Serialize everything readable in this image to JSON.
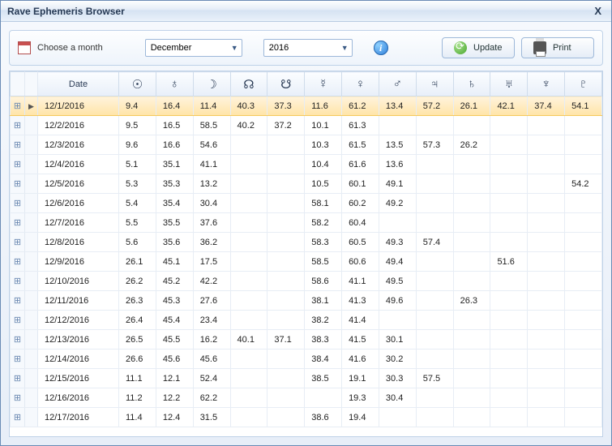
{
  "window": {
    "title": "Rave Ephemeris Browser",
    "close": "X"
  },
  "toolbar": {
    "choose_label": "Choose a month",
    "month_value": "December",
    "year_value": "2016",
    "update_label": "Update",
    "print_label": "Print"
  },
  "columns": [
    {
      "key": "date",
      "label": "Date",
      "header_type": "text"
    },
    {
      "key": "sun",
      "label": "☉",
      "header_type": "symbol"
    },
    {
      "key": "earth",
      "label": "♁",
      "header_type": "symbol"
    },
    {
      "key": "moon",
      "label": "☽",
      "header_type": "symbol"
    },
    {
      "key": "north_node",
      "label": "☊",
      "header_type": "symbol"
    },
    {
      "key": "south_node",
      "label": "☋",
      "header_type": "symbol"
    },
    {
      "key": "mercury",
      "label": "☿",
      "header_type": "symbol"
    },
    {
      "key": "venus",
      "label": "♀",
      "header_type": "symbol"
    },
    {
      "key": "mars",
      "label": "♂",
      "header_type": "symbol"
    },
    {
      "key": "jupiter",
      "label": "♃",
      "header_type": "symbol"
    },
    {
      "key": "saturn",
      "label": "♄",
      "header_type": "symbol"
    },
    {
      "key": "uranus",
      "label": "♅",
      "header_type": "symbol"
    },
    {
      "key": "neptune",
      "label": "♆",
      "header_type": "symbol"
    },
    {
      "key": "pluto",
      "label": "♇",
      "header_type": "symbol"
    }
  ],
  "rows": [
    {
      "selected": true,
      "date": "12/1/2016",
      "vals": [
        "9.4",
        "16.4",
        "11.4",
        "40.3",
        "37.3",
        "11.6",
        "61.2",
        "13.4",
        "57.2",
        "26.1",
        "42.1",
        "37.4",
        "54.1"
      ]
    },
    {
      "date": "12/2/2016",
      "vals": [
        "9.5",
        "16.5",
        "58.5",
        "40.2",
        "37.2",
        "10.1",
        "61.3",
        "",
        "",
        "",
        "",
        "",
        ""
      ]
    },
    {
      "date": "12/3/2016",
      "vals": [
        "9.6",
        "16.6",
        "54.6",
        "",
        "",
        "10.3",
        "61.5",
        "13.5",
        "57.3",
        "26.2",
        "",
        "",
        ""
      ]
    },
    {
      "date": "12/4/2016",
      "vals": [
        "5.1",
        "35.1",
        "41.1",
        "",
        "",
        "10.4",
        "61.6",
        "13.6",
        "",
        "",
        "",
        "",
        ""
      ]
    },
    {
      "date": "12/5/2016",
      "vals": [
        "5.3",
        "35.3",
        "13.2",
        "",
        "",
        "10.5",
        "60.1",
        "49.1",
        "",
        "",
        "",
        "",
        "54.2"
      ]
    },
    {
      "date": "12/6/2016",
      "vals": [
        "5.4",
        "35.4",
        "30.4",
        "",
        "",
        "58.1",
        "60.2",
        "49.2",
        "",
        "",
        "",
        "",
        ""
      ]
    },
    {
      "date": "12/7/2016",
      "vals": [
        "5.5",
        "35.5",
        "37.6",
        "",
        "",
        "58.2",
        "60.4",
        "",
        "",
        "",
        "",
        "",
        ""
      ]
    },
    {
      "date": "12/8/2016",
      "vals": [
        "5.6",
        "35.6",
        "36.2",
        "",
        "",
        "58.3",
        "60.5",
        "49.3",
        "57.4",
        "",
        "",
        "",
        ""
      ]
    },
    {
      "date": "12/9/2016",
      "vals": [
        "26.1",
        "45.1",
        "17.5",
        "",
        "",
        "58.5",
        "60.6",
        "49.4",
        "",
        "",
        "51.6",
        "",
        ""
      ]
    },
    {
      "date": "12/10/2016",
      "vals": [
        "26.2",
        "45.2",
        "42.2",
        "",
        "",
        "58.6",
        "41.1",
        "49.5",
        "",
        "",
        "",
        "",
        ""
      ]
    },
    {
      "date": "12/11/2016",
      "vals": [
        "26.3",
        "45.3",
        "27.6",
        "",
        "",
        "38.1",
        "41.3",
        "49.6",
        "",
        "26.3",
        "",
        "",
        ""
      ]
    },
    {
      "date": "12/12/2016",
      "vals": [
        "26.4",
        "45.4",
        "23.4",
        "",
        "",
        "38.2",
        "41.4",
        "",
        "",
        "",
        "",
        "",
        ""
      ]
    },
    {
      "date": "12/13/2016",
      "vals": [
        "26.5",
        "45.5",
        "16.2",
        "40.1",
        "37.1",
        "38.3",
        "41.5",
        "30.1",
        "",
        "",
        "",
        "",
        ""
      ]
    },
    {
      "date": "12/14/2016",
      "vals": [
        "26.6",
        "45.6",
        "45.6",
        "",
        "",
        "38.4",
        "41.6",
        "30.2",
        "",
        "",
        "",
        "",
        ""
      ]
    },
    {
      "date": "12/15/2016",
      "vals": [
        "11.1",
        "12.1",
        "52.4",
        "",
        "",
        "38.5",
        "19.1",
        "30.3",
        "57.5",
        "",
        "",
        "",
        ""
      ]
    },
    {
      "date": "12/16/2016",
      "vals": [
        "11.2",
        "12.2",
        "62.2",
        "",
        "",
        "",
        "19.3",
        "30.4",
        "",
        "",
        "",
        "",
        ""
      ]
    },
    {
      "date": "12/17/2016",
      "vals": [
        "11.4",
        "12.4",
        "31.5",
        "",
        "",
        "38.6",
        "19.4",
        "",
        "",
        "",
        "",
        "",
        ""
      ]
    }
  ]
}
